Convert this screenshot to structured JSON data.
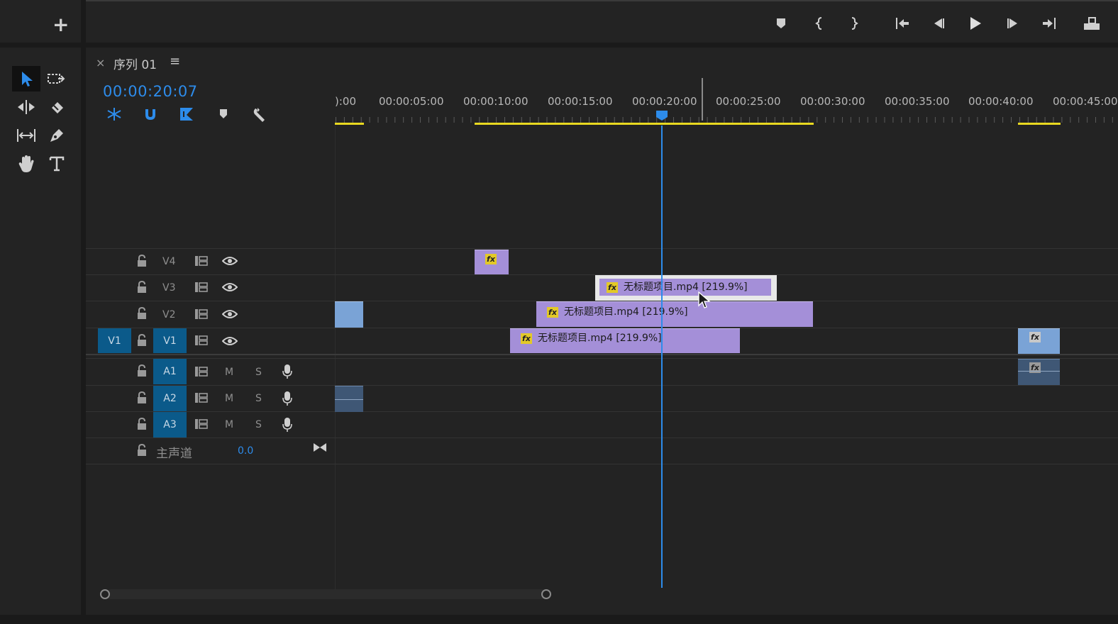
{
  "transport": {
    "add_label": "+"
  },
  "sequence": {
    "close_label": "×",
    "title": "序列 01",
    "menu_label": "≡",
    "timecode": "00:00:20:07"
  },
  "ruler": {
    "labels": [
      "):00",
      "00:00:05:00",
      "00:00:10:00",
      "00:00:15:00",
      "00:00:20:00",
      "00:00:25:00",
      "00:00:30:00",
      "00:00:35:00",
      "00:00:40:00",
      "00:00:45:00"
    ]
  },
  "tracks": {
    "video": [
      {
        "label": "V4"
      },
      {
        "label": "V3"
      },
      {
        "label": "V2"
      },
      {
        "label": "V1",
        "source": "V1"
      }
    ],
    "audio": [
      {
        "label": "A1",
        "mute": "M",
        "solo": "S"
      },
      {
        "label": "A2",
        "mute": "M",
        "solo": "S"
      },
      {
        "label": "A3",
        "mute": "M",
        "solo": "S"
      }
    ],
    "master": {
      "label": "主声道",
      "value": "0.0"
    }
  },
  "clips": {
    "v4_fx": "fx",
    "v3": {
      "fx": "fx",
      "name": "无标题项目.mp4 [219.9%]"
    },
    "v2": {
      "fx": "fx",
      "name": "无标题项目.mp4 [219.9%]"
    },
    "v1": {
      "fx": "fx",
      "name": "无标题项目.mp4 [219.9%]"
    },
    "v1_end_fx": "fx",
    "a1_end_fx": "fx"
  },
  "colors": {
    "accent_blue": "#2d8ceb",
    "clip_purple": "#a48fd8",
    "track_blue": "#0b5a8a",
    "work_area_yellow": "#e8d820"
  }
}
